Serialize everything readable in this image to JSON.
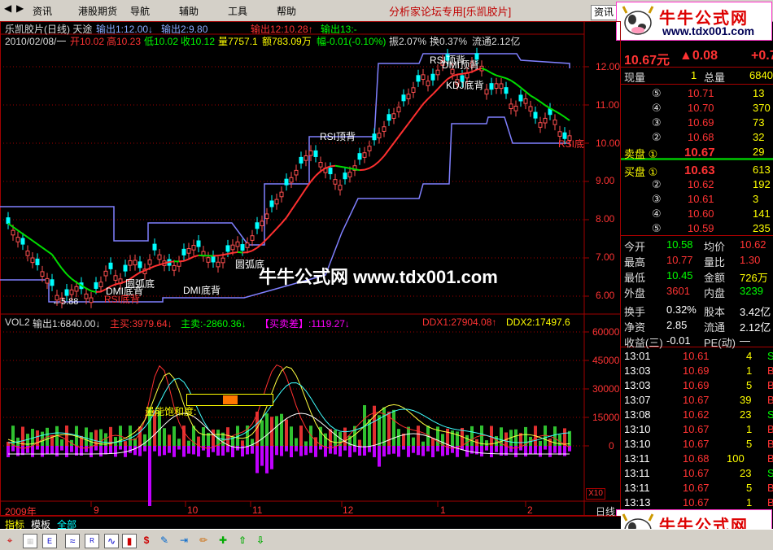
{
  "menu": {
    "items": [
      "资讯",
      "港股期货",
      "导航",
      "辅助",
      "工具",
      "帮助"
    ],
    "title": "分析家论坛专用[乐凯胶片]",
    "search_btn": "资讯",
    "win_buttons": [
      "_",
      "□",
      "×"
    ]
  },
  "logo": {
    "text": "牛牛公式网",
    "url": "www.tdx001.com"
  },
  "watermark": "牛牛公式网 www.tdx001.com",
  "price_chart": {
    "title": "乐凯胶片(日线) 天途",
    "out1": "输出1:12.00↓",
    "out2": "输出2:9.80",
    "out12": "输出12:10.28↑",
    "out13": "输出13:-",
    "date": "2010/02/08/一",
    "open": "开10.02",
    "high": "高10.23",
    "low": "低10.02",
    "close": "收10.12",
    "vol": "量7757.1",
    "amt": "额783.09万",
    "chg": "幅-0.01(-0.10%)",
    "amp": "振2.07%",
    "turn": "换0.37%",
    "float": "流通2.12亿",
    "yticks": [
      "12.00",
      "11.00",
      "10.00",
      "9.00",
      "8.00",
      "7.00",
      "6.00"
    ],
    "ann": [
      "RSI顶背",
      "RSI顶背",
      "DMI顶背",
      "KDJ底背",
      "RSI底",
      "圆弧底",
      "圆弧底",
      "DMI底背",
      "DMI底背",
      "RSI底背",
      "←5.88"
    ]
  },
  "vol_chart": {
    "name": "VOL2",
    "out1": "输出1:6840.00↓",
    "main_buy": "主买:3979.64↓",
    "main_sell": "主卖:-2860.36↓",
    "diff": "【买卖差】:1119.27↓",
    "ddx1": "DDX1:27904.08↑",
    "ddx2": "DDX2:17497.6",
    "label": "量能饱和度:",
    "yticks": [
      "60000",
      "45000",
      "30000",
      "15000",
      "0"
    ],
    "x10": "X10"
  },
  "xaxis": [
    "2009年",
    "9",
    "10",
    "11",
    "12",
    "1",
    "2"
  ],
  "xaxis_right": "日线",
  "quote": {
    "price": "10.67元",
    "chg": "▲0.08",
    "chg2": "+0.7",
    "vol_label": "现量",
    "vol_val": "1",
    "total_label": "总量",
    "total_val": "6840",
    "asks": [
      {
        "n": "⑤",
        "p": "10.71",
        "v": "13"
      },
      {
        "n": "④",
        "p": "10.70",
        "v": "370"
      },
      {
        "n": "③",
        "p": "10.69",
        "v": "73"
      },
      {
        "n": "②",
        "p": "10.68",
        "v": "32"
      },
      {
        "n": "卖盘 ①",
        "p": "10.67",
        "v": "29"
      }
    ],
    "bids": [
      {
        "n": "买盘 ①",
        "p": "10.63",
        "v": "613"
      },
      {
        "n": "②",
        "p": "10.62",
        "v": "192"
      },
      {
        "n": "③",
        "p": "10.61",
        "v": "3"
      },
      {
        "n": "④",
        "p": "10.60",
        "v": "141"
      },
      {
        "n": "⑤",
        "p": "10.59",
        "v": "235"
      }
    ],
    "stats": [
      {
        "a": "今开",
        "b": "10.58",
        "c": "均价",
        "d": "10.62"
      },
      {
        "a": "最高",
        "b": "10.77",
        "c": "量比",
        "d": "1.30"
      },
      {
        "a": "最低",
        "b": "10.45",
        "c": "金额",
        "d": "726万"
      },
      {
        "a": "外盘",
        "b": "3601",
        "c": "内盘",
        "d": "3239"
      },
      {
        "a": "换手",
        "b": "0.32%",
        "c": "股本",
        "d": "3.42亿"
      },
      {
        "a": "净资",
        "b": "2.85",
        "c": "流通",
        "d": "2.12亿"
      },
      {
        "a": "收益(三)",
        "b": "-0.01",
        "c": "PE(动)",
        "d": "—"
      }
    ],
    "ticks": [
      {
        "t": "13:01",
        "p": "10.61",
        "v": "4",
        "s": "S"
      },
      {
        "t": "13:03",
        "p": "10.69",
        "v": "1",
        "s": "B"
      },
      {
        "t": "13:03",
        "p": "10.69",
        "v": "5",
        "s": "B"
      },
      {
        "t": "13:07",
        "p": "10.67",
        "v": "39",
        "s": "B"
      },
      {
        "t": "13:08",
        "p": "10.62",
        "v": "23",
        "s": "S"
      },
      {
        "t": "13:10",
        "p": "10.67",
        "v": "1",
        "s": "B"
      },
      {
        "t": "13:10",
        "p": "10.67",
        "v": "5",
        "s": "B"
      },
      {
        "t": "13:11",
        "p": "10.68",
        "v": "100",
        "s": "B"
      },
      {
        "t": "13:11",
        "p": "10.67",
        "v": "23",
        "s": "S"
      },
      {
        "t": "13:11",
        "p": "10.67",
        "v": "5",
        "s": "B"
      },
      {
        "t": "13:13",
        "p": "10.67",
        "v": "1",
        "s": "B"
      }
    ]
  },
  "tabs": [
    "指标",
    "模板",
    "全部"
  ],
  "colors": {
    "red": "#ff3232",
    "green": "#00e600",
    "blue": "#8080ff",
    "yellow": "#ffff00",
    "cyan": "#00ffff",
    "magenta": "#ff00ff",
    "grid": "#a00000"
  }
}
